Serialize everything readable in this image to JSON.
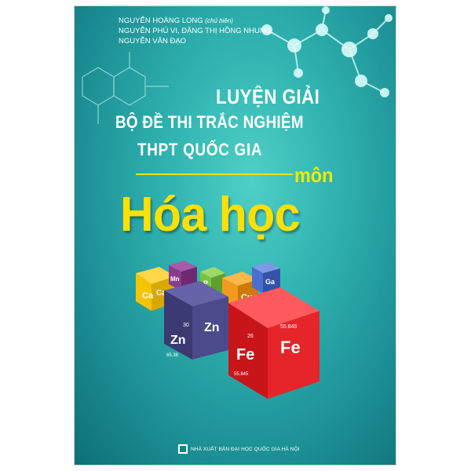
{
  "book": {
    "authors": {
      "line1": "NGUYỄN HOÀNG LONG",
      "line1_role": "(chủ biên)",
      "line2": "NGUYỄN PHÚ VI, ĐẶNG THỊ HỒNG NHUNG,",
      "line3": "NGUYỄN VĂN ĐẠO"
    },
    "title_line1": "LUYỆN GIẢI",
    "title_line2": "BỘ ĐỀ THI TRẮC NGHIỆM",
    "title_line3": "THPT QUỐC GIA",
    "subject_prefix": "môn",
    "subject": "Hóa học",
    "publisher": "NHÀ XUẤT BẢN ĐẠI HỌC QUỐC GIA HÀ NỘI"
  },
  "cubes": [
    {
      "symbol": "Ca",
      "color": "#f5c400"
    },
    {
      "symbol": "Mn",
      "color": "#8a3c8c"
    },
    {
      "symbol": "P",
      "color": "#7cc242"
    },
    {
      "symbol": "Cu",
      "color": "#f29a1d"
    },
    {
      "symbol": "Ga",
      "color": "#4a6fd1"
    },
    {
      "symbol": "Zn",
      "number": "30",
      "mass": "65.38",
      "color": "#4b4a8a"
    },
    {
      "symbol": "Fe",
      "number": "26",
      "mass": "55.845",
      "color": "#e5252a"
    }
  ],
  "colors": {
    "cover_bg": "#2fb2b0",
    "title": "#ffffff",
    "subject": "#ffe100"
  }
}
